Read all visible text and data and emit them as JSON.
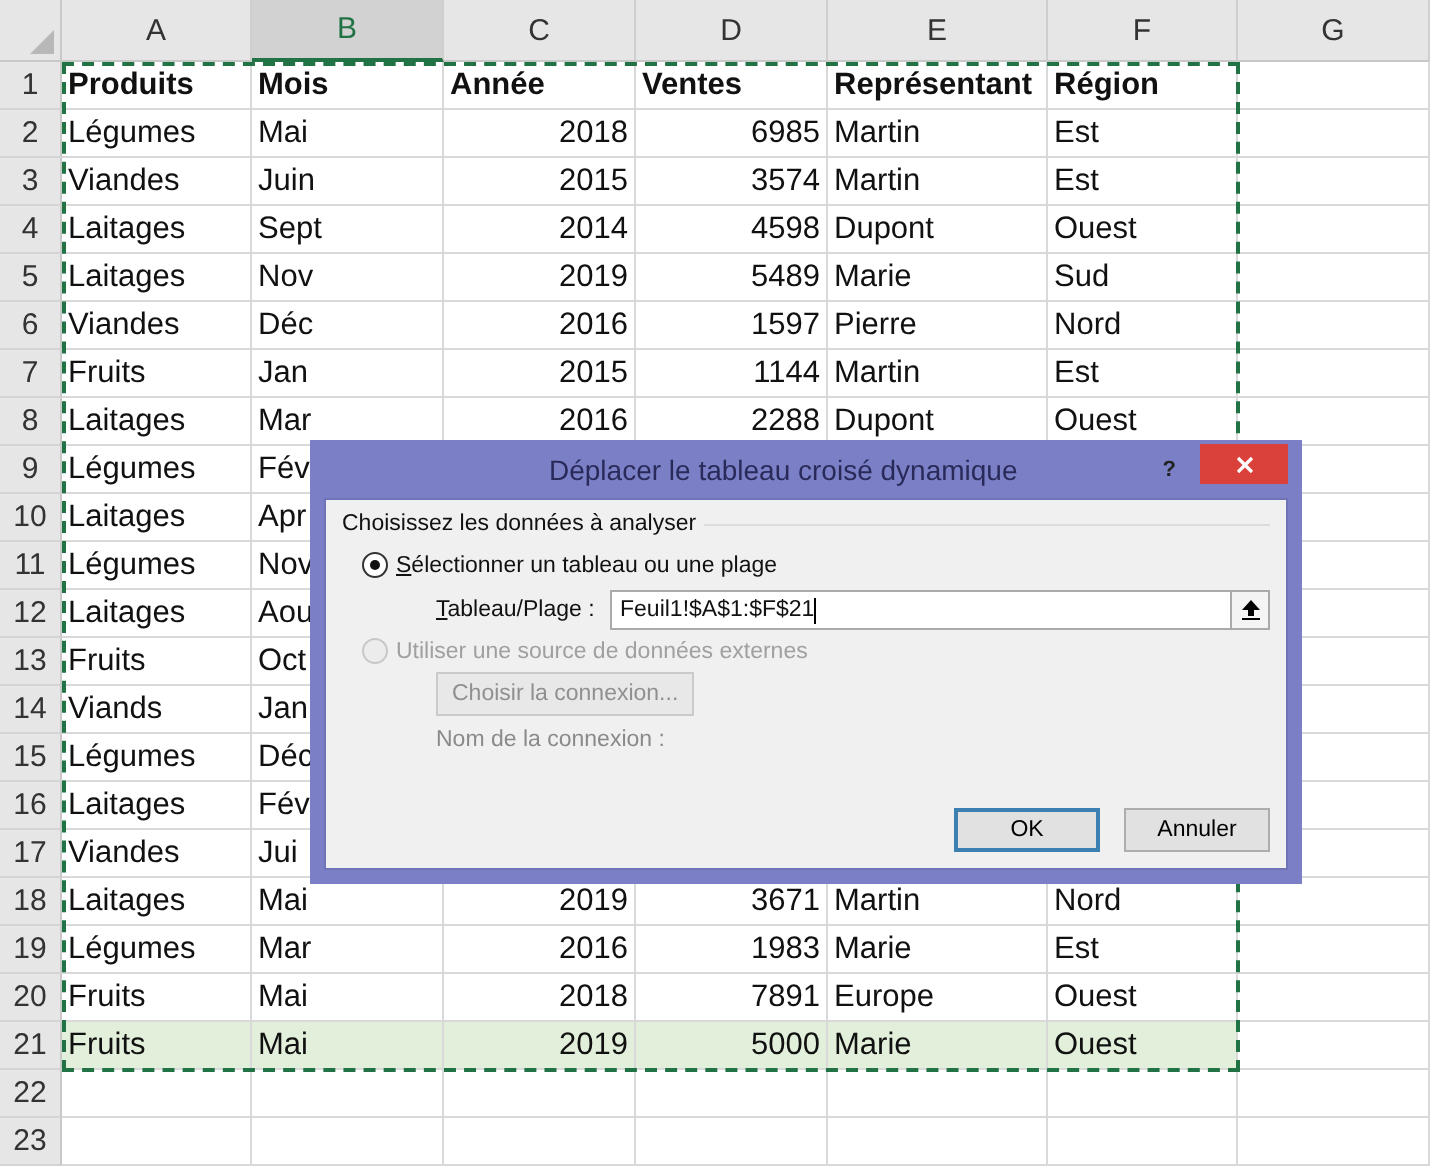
{
  "sheet": {
    "columns": [
      {
        "label": "A",
        "selected": false
      },
      {
        "label": "B",
        "selected": true
      },
      {
        "label": "C",
        "selected": false
      },
      {
        "label": "D",
        "selected": false
      },
      {
        "label": "E",
        "selected": false
      },
      {
        "label": "F",
        "selected": false
      },
      {
        "label": "G",
        "selected": false
      }
    ],
    "header_row": {
      "number": "1",
      "cells": [
        "Produits",
        "Mois",
        "Année",
        "Ventes",
        "Représentant",
        "Région"
      ]
    },
    "rows": [
      {
        "number": "2",
        "highlighted": false,
        "cells": [
          "Légumes",
          "Mai",
          "2018",
          "6985",
          "Martin",
          "Est"
        ]
      },
      {
        "number": "3",
        "highlighted": false,
        "cells": [
          "Viandes",
          "Juin",
          "2015",
          "3574",
          "Martin",
          "Est"
        ]
      },
      {
        "number": "4",
        "highlighted": false,
        "cells": [
          "Laitages",
          "Sept",
          "2014",
          "4598",
          "Dupont",
          "Ouest"
        ]
      },
      {
        "number": "5",
        "highlighted": false,
        "cells": [
          "Laitages",
          "Nov",
          "2019",
          "5489",
          "Marie",
          "Sud"
        ]
      },
      {
        "number": "6",
        "highlighted": false,
        "cells": [
          "Viandes",
          "Déc",
          "2016",
          "1597",
          "Pierre",
          "Nord"
        ]
      },
      {
        "number": "7",
        "highlighted": false,
        "cells": [
          "Fruits",
          "Jan",
          "2015",
          "1144",
          "Martin",
          "Est"
        ]
      },
      {
        "number": "8",
        "highlighted": false,
        "cells": [
          "Laitages",
          "Mar",
          "2016",
          "2288",
          "Dupont",
          "Ouest"
        ]
      },
      {
        "number": "9",
        "highlighted": false,
        "cells": [
          "Légumes",
          "Fév"
        ]
      },
      {
        "number": "10",
        "highlighted": false,
        "cells": [
          "Laitages",
          "Apr"
        ]
      },
      {
        "number": "11",
        "highlighted": false,
        "cells": [
          "Légumes",
          "Nov"
        ]
      },
      {
        "number": "12",
        "highlighted": false,
        "cells": [
          "Laitages",
          "Aou"
        ]
      },
      {
        "number": "13",
        "highlighted": false,
        "cells": [
          "Fruits",
          "Oct"
        ]
      },
      {
        "number": "14",
        "highlighted": false,
        "cells": [
          "Viands",
          "Jan"
        ]
      },
      {
        "number": "15",
        "highlighted": false,
        "cells": [
          "Légumes",
          "Déc"
        ]
      },
      {
        "number": "16",
        "highlighted": false,
        "cells": [
          "Laitages",
          "Fév"
        ]
      },
      {
        "number": "17",
        "highlighted": false,
        "cells": [
          "Viandes",
          "Jui"
        ]
      },
      {
        "number": "18",
        "highlighted": false,
        "cells": [
          "Laitages",
          "Mai",
          "2019",
          "3671",
          "Martin",
          "Nord"
        ]
      },
      {
        "number": "19",
        "highlighted": false,
        "cells": [
          "Légumes",
          "Mar",
          "2016",
          "1983",
          "Marie",
          "Est"
        ]
      },
      {
        "number": "20",
        "highlighted": false,
        "cells": [
          "Fruits",
          "Mai",
          "2018",
          "7891",
          "Europe",
          "Ouest"
        ]
      },
      {
        "number": "21",
        "highlighted": true,
        "cells": [
          "Fruits",
          "Mai",
          "2019",
          "5000",
          "Marie",
          "Ouest"
        ]
      },
      {
        "number": "22",
        "highlighted": false,
        "cells": []
      },
      {
        "number": "23",
        "highlighted": false,
        "cells": []
      }
    ]
  },
  "dialog": {
    "title": "Déplacer le tableau croisé dynamique",
    "help": "?",
    "group_label": "Choisissez les données à analyser",
    "options": [
      {
        "label": "Sélectionner un tableau ou une plage",
        "selected": true,
        "disabled": false,
        "underline_first": true
      },
      {
        "label": "Utiliser une source de données externes",
        "selected": false,
        "disabled": true,
        "underline_first": false
      }
    ],
    "range_field": {
      "label": "Tableau/Plage :",
      "value": "Feuil1!$A$1:$F$21"
    },
    "connection_button": {
      "label": "Choisir la connexion...",
      "disabled": true
    },
    "connection_label": "Nom de la connexion :",
    "buttons": [
      {
        "label": "OK",
        "default": true
      },
      {
        "label": "Annuler",
        "default": false
      }
    ]
  }
}
